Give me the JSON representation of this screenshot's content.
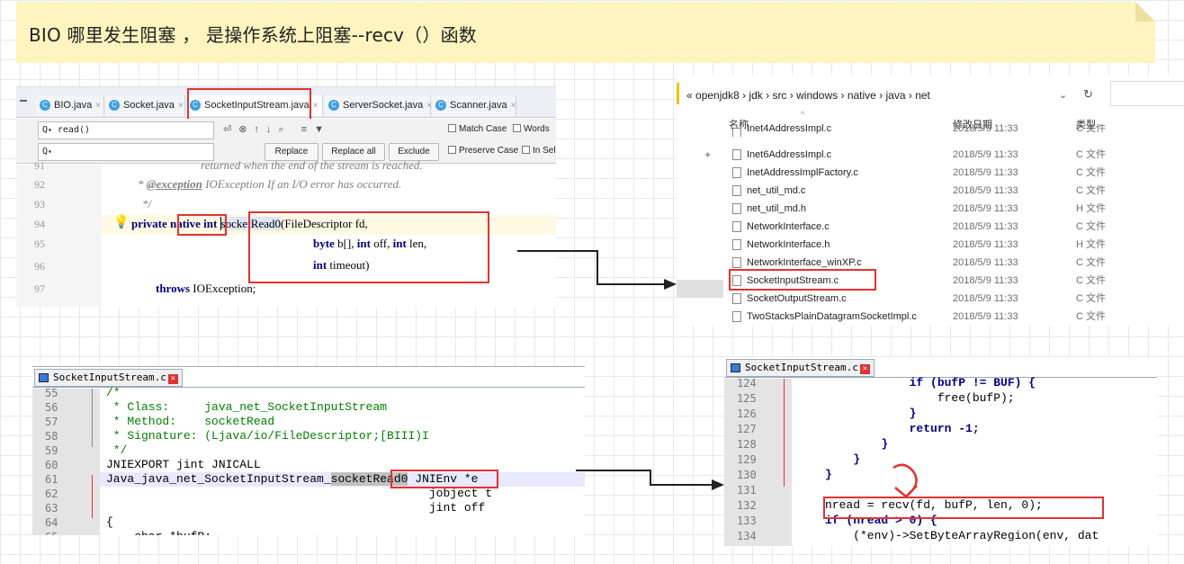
{
  "banner": {
    "text": "BIO  哪里发生阻塞 ， 是操作系统上阻塞--recv（）函数"
  },
  "ide": {
    "tabs": [
      {
        "label": "BIO.java",
        "icon": "class-icon"
      },
      {
        "label": "Socket.java",
        "icon": "class-icon"
      },
      {
        "label": "SocketInputStream.java",
        "icon": "class-icon"
      },
      {
        "label": "ServerSocket.java",
        "icon": "class-icon"
      },
      {
        "label": "Scanner.java",
        "icon": "class-icon"
      }
    ],
    "find": {
      "search_value": "read()",
      "replace_value": "",
      "replace_label": "Replace",
      "replace_all_label": "Replace all",
      "exclude_label": "Exclude",
      "match_case_label": "Match Case",
      "words_label": "Words",
      "preserve_case_label": "Preserve Case",
      "in_selection_label": "In Sel"
    },
    "lines": [
      {
        "num": "91",
        "text": "returned when the end of the stream is reached."
      },
      {
        "num": "92",
        "tag": "@exception",
        "text": " IOException If an I/O error has occurred."
      },
      {
        "num": "93",
        "text": "*/"
      },
      {
        "num": "94",
        "kw1": "private",
        "kw2": "native",
        "kw3": "int",
        "method": "socketRead0",
        "rest": "(FileDescriptor fd,"
      },
      {
        "num": "95",
        "kw": "byte",
        "rest": " b[], ",
        "kw2": "int",
        "rest2": " off, ",
        "kw3": "int",
        "rest3": " len,"
      },
      {
        "num": "96",
        "kw": "int",
        "rest": " timeout)"
      },
      {
        "num": "97",
        "kw": "throws",
        "rest": " IOException;"
      }
    ]
  },
  "explorer": {
    "breadcrumb": [
      "openjdk8",
      "jdk",
      "src",
      "windows",
      "native",
      "java",
      "net"
    ],
    "columns": {
      "name": "名称",
      "date": "修改日期",
      "type": "类型"
    },
    "files": [
      {
        "name": "Inet4AddressImpl.c",
        "date": "2018/5/9 11:33",
        "type": "C 文件"
      },
      {
        "name": "Inet6AddressImpl.c",
        "date": "2018/5/9 11:33",
        "type": "C 文件"
      },
      {
        "name": "InetAddressImplFactory.c",
        "date": "2018/5/9 11:33",
        "type": "C 文件"
      },
      {
        "name": "net_util_md.c",
        "date": "2018/5/9 11:33",
        "type": "C 文件"
      },
      {
        "name": "net_util_md.h",
        "date": "2018/5/9 11:33",
        "type": "H 文件"
      },
      {
        "name": "NetworkInterface.c",
        "date": "2018/5/9 11:33",
        "type": "C 文件"
      },
      {
        "name": "NetworkInterface.h",
        "date": "2018/5/9 11:33",
        "type": "H 文件"
      },
      {
        "name": "NetworkInterface_winXP.c",
        "date": "2018/5/9 11:33",
        "type": "C 文件"
      },
      {
        "name": "SocketInputStream.c",
        "date": "2018/5/9 11:33",
        "type": "C 文件"
      },
      {
        "name": "SocketOutputStream.c",
        "date": "2018/5/9 11:33",
        "type": "C 文件"
      },
      {
        "name": "TwoStacksPlainDatagramSocketImpl.c",
        "date": "2018/5/9 11:33",
        "type": "C 文件"
      }
    ]
  },
  "np_left": {
    "tab": "SocketInputStream.c",
    "lines": [
      {
        "num": "55",
        "text": "/*"
      },
      {
        "num": "56",
        "text": " * Class:     java_net_SocketInputStream"
      },
      {
        "num": "57",
        "text": " * Method:    socketRead"
      },
      {
        "num": "58",
        "text": " * Signature: (Ljava/io/FileDescriptor;[BIII)I"
      },
      {
        "num": "59",
        "text": " */"
      },
      {
        "num": "60",
        "text": "JNIEXPORT jint JNICALL"
      },
      {
        "num": "61",
        "prefix": "Java_java_net_SocketInputStream_",
        "fn": "socketRead0",
        "suffix": " JNIEnv *e"
      },
      {
        "num": "62",
        "text": "                                              jobject t"
      },
      {
        "num": "63",
        "text": "                                              jint off"
      },
      {
        "num": "64",
        "text": "{"
      },
      {
        "num": "65",
        "text": "    char *bufP;"
      }
    ]
  },
  "np_right": {
    "tab": "SocketInputStream.c",
    "lines": [
      {
        "num": "124",
        "text": "            if (bufP != BUF) {"
      },
      {
        "num": "125",
        "text": "                free(bufP);"
      },
      {
        "num": "126",
        "text": "            }"
      },
      {
        "num": "127",
        "text": "            return -1;"
      },
      {
        "num": "128",
        "text": "        }"
      },
      {
        "num": "129",
        "text": "    }"
      },
      {
        "num": "130",
        "text": "}"
      },
      {
        "num": "131",
        "text": ""
      },
      {
        "num": "132",
        "text": "nread = recv(fd, bufP, len, 0);"
      },
      {
        "num": "133",
        "text": "if (nread > 0) {"
      },
      {
        "num": "134",
        "text": "    (*env)->SetByteArrayRegion(env, dat"
      }
    ]
  },
  "colors": {
    "highlight": "#e23232",
    "keyword": "#000080",
    "comment": "#008000",
    "banner": "#fdf4bf"
  }
}
